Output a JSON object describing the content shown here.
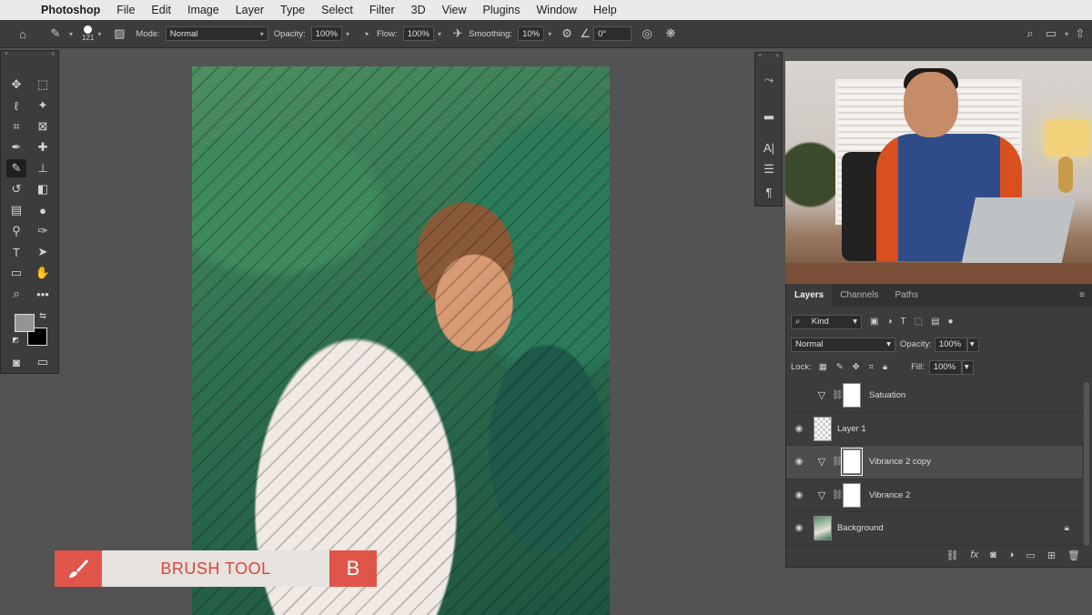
{
  "menubar": {
    "app_name": "Photoshop",
    "items": [
      "File",
      "Edit",
      "Image",
      "Layer",
      "Type",
      "Select",
      "Filter",
      "3D",
      "View",
      "Plugins",
      "Window",
      "Help"
    ]
  },
  "options": {
    "brush_size": "121",
    "mode_label": "Mode:",
    "mode_value": "Normal",
    "opacity_label": "Opacity:",
    "opacity_value": "100%",
    "flow_label": "Flow:",
    "flow_value": "100%",
    "smoothing_label": "Smoothing:",
    "smoothing_value": "10%",
    "angle_value": "0°"
  },
  "toolbar": {
    "fg_color": "#959595",
    "bg_color": "#000000"
  },
  "overlay": {
    "label": "BRUSH TOOL",
    "key": "B",
    "accent": "#e0554a"
  },
  "layers_panel": {
    "tabs": [
      "Layers",
      "Channels",
      "Paths"
    ],
    "kind_label": "Kind",
    "blend_mode": "Normal",
    "opacity_label": "Opacity:",
    "opacity_value": "100%",
    "lock_label": "Lock:",
    "fill_label": "Fill:",
    "fill_value": "100%",
    "layers": [
      {
        "name": "Satuation",
        "visible": false
      },
      {
        "name": "Layer 1",
        "visible": true
      },
      {
        "name": "Vibrance 2 copy",
        "visible": true,
        "selected": true
      },
      {
        "name": "Vibrance 2",
        "visible": true
      },
      {
        "name": "Background",
        "visible": true,
        "locked": true
      }
    ]
  }
}
